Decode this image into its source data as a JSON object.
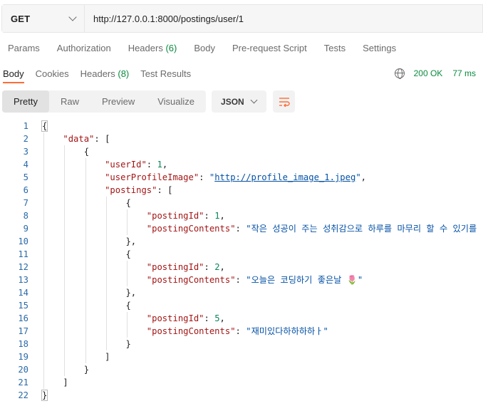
{
  "request": {
    "method": "GET",
    "url": "http://127.0.0.1:8000/postings/user/1",
    "tabs": [
      {
        "label": "Params",
        "count": ""
      },
      {
        "label": "Authorization",
        "count": ""
      },
      {
        "label": "Headers",
        "count": "(6)"
      },
      {
        "label": "Body",
        "count": ""
      },
      {
        "label": "Pre-request Script",
        "count": ""
      },
      {
        "label": "Tests",
        "count": ""
      },
      {
        "label": "Settings",
        "count": ""
      }
    ]
  },
  "response": {
    "tabs": [
      {
        "label": "Body",
        "count": ""
      },
      {
        "label": "Cookies",
        "count": ""
      },
      {
        "label": "Headers",
        "count": "(8)"
      },
      {
        "label": "Test Results",
        "count": ""
      }
    ],
    "status": "200 OK",
    "time": "77 ms",
    "view_modes": [
      "Pretty",
      "Raw",
      "Preview",
      "Visualize"
    ],
    "active_view": "Pretty",
    "format": "JSON",
    "icons": {
      "globe": "globe-icon",
      "wrap": "wrap-lines-icon",
      "dropdown": "chevron-down-icon"
    },
    "colors": {
      "accent": "#ff6c37",
      "status": "#0b8a3e",
      "key": "#a31515",
      "string": "#0451a5",
      "number": "#098658"
    }
  },
  "code_lines": [
    {
      "num": "1",
      "indent": 0,
      "tokens": [
        [
          "p",
          "{"
        ]
      ]
    },
    {
      "num": "2",
      "indent": 1,
      "tokens": [
        [
          "k",
          "\"data\""
        ],
        [
          "p",
          ": ["
        ]
      ]
    },
    {
      "num": "3",
      "indent": 2,
      "tokens": [
        [
          "p",
          "{"
        ]
      ]
    },
    {
      "num": "4",
      "indent": 3,
      "tokens": [
        [
          "k",
          "\"userId\""
        ],
        [
          "p",
          ": "
        ],
        [
          "n",
          "1"
        ],
        [
          "p",
          ","
        ]
      ]
    },
    {
      "num": "5",
      "indent": 3,
      "tokens": [
        [
          "k",
          "\"userProfileImage\""
        ],
        [
          "p",
          ": "
        ],
        [
          "s",
          "\""
        ],
        [
          "u",
          "http://profile_image_1.jpeg"
        ],
        [
          "s",
          "\""
        ],
        [
          "p",
          ","
        ]
      ]
    },
    {
      "num": "6",
      "indent": 3,
      "tokens": [
        [
          "k",
          "\"postings\""
        ],
        [
          "p",
          ": ["
        ]
      ]
    },
    {
      "num": "7",
      "indent": 4,
      "tokens": [
        [
          "p",
          "{"
        ]
      ]
    },
    {
      "num": "8",
      "indent": 5,
      "tokens": [
        [
          "k",
          "\"postingId\""
        ],
        [
          "p",
          ": "
        ],
        [
          "n",
          "1"
        ],
        [
          "p",
          ","
        ]
      ]
    },
    {
      "num": "9",
      "indent": 5,
      "tokens": [
        [
          "k",
          "\"postingContents\""
        ],
        [
          "p",
          ": "
        ],
        [
          "s",
          "\"작은 성공이 주는 성취감으로 하루를 마무리 할 수 있기를 ❣️\""
        ]
      ]
    },
    {
      "num": "10",
      "indent": 4,
      "tokens": [
        [
          "p",
          "},"
        ]
      ]
    },
    {
      "num": "11",
      "indent": 4,
      "tokens": [
        [
          "p",
          "{"
        ]
      ]
    },
    {
      "num": "12",
      "indent": 5,
      "tokens": [
        [
          "k",
          "\"postingId\""
        ],
        [
          "p",
          ": "
        ],
        [
          "n",
          "2"
        ],
        [
          "p",
          ","
        ]
      ]
    },
    {
      "num": "13",
      "indent": 5,
      "tokens": [
        [
          "k",
          "\"postingContents\""
        ],
        [
          "p",
          ": "
        ],
        [
          "s",
          "\"오늘은 코딩하기 좋은날 🌷\""
        ]
      ]
    },
    {
      "num": "14",
      "indent": 4,
      "tokens": [
        [
          "p",
          "},"
        ]
      ]
    },
    {
      "num": "15",
      "indent": 4,
      "tokens": [
        [
          "p",
          "{"
        ]
      ]
    },
    {
      "num": "16",
      "indent": 5,
      "tokens": [
        [
          "k",
          "\"postingId\""
        ],
        [
          "p",
          ": "
        ],
        [
          "n",
          "5"
        ],
        [
          "p",
          ","
        ]
      ]
    },
    {
      "num": "17",
      "indent": 5,
      "tokens": [
        [
          "k",
          "\"postingContents\""
        ],
        [
          "p",
          ": "
        ],
        [
          "s",
          "\"재미있다하하하하ㅏ\""
        ]
      ]
    },
    {
      "num": "18",
      "indent": 4,
      "tokens": [
        [
          "p",
          "}"
        ]
      ]
    },
    {
      "num": "19",
      "indent": 3,
      "tokens": [
        [
          "p",
          "]"
        ]
      ]
    },
    {
      "num": "20",
      "indent": 2,
      "tokens": [
        [
          "p",
          "}"
        ]
      ]
    },
    {
      "num": "21",
      "indent": 1,
      "tokens": [
        [
          "p",
          "]"
        ]
      ]
    },
    {
      "num": "22",
      "indent": 0,
      "tokens": [
        [
          "p",
          "}"
        ]
      ]
    }
  ]
}
